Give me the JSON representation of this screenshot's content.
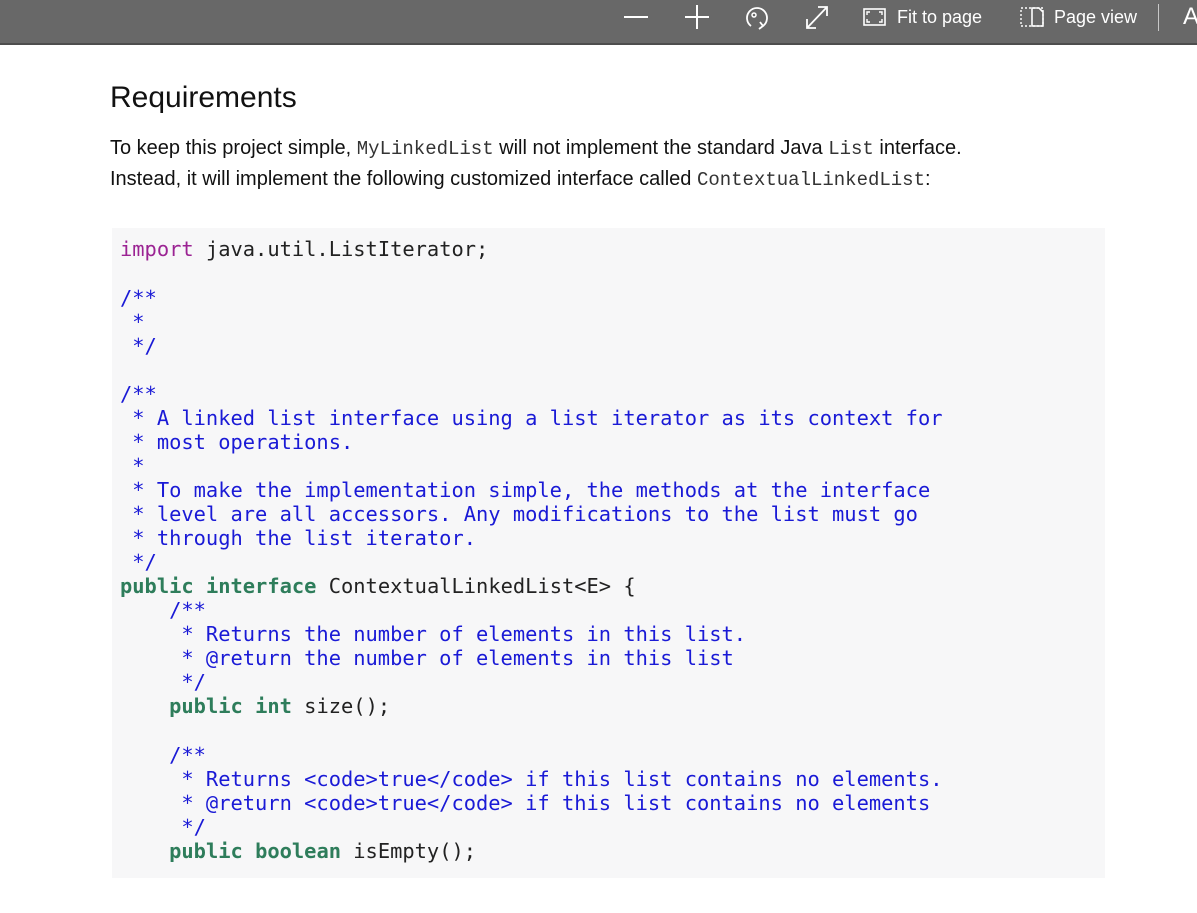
{
  "toolbar": {
    "zoom_out_icon": "minus-icon",
    "zoom_in_icon": "plus-icon",
    "rotate_icon": "rotate-icon",
    "fullscreen_icon": "expand-icon",
    "fit_to_page_label": "Fit to page",
    "page_view_label": "Page view",
    "overflow_label": "A"
  },
  "document": {
    "heading": "Requirements",
    "para": {
      "line1_a": "To keep this project simple, ",
      "line1_code1": "MyLinkedList",
      "line1_b": " will not implement the standard Java ",
      "line1_code2": "List",
      "line1_c": " interface.",
      "line2_a": "Instead, it will implement the following customized interface called ",
      "line2_code": "ContextualLinkedList",
      "line2_b": ":"
    },
    "code": {
      "l1_kw": "import",
      "l1_rest": " java.util.ListIterator;",
      "l2": "/**",
      "l3": " *",
      "l4": " */",
      "l5": "/**",
      "l6": " * A linked list interface using a list iterator as its context for",
      "l7": " * most operations.",
      "l8": " *",
      "l9": " * To make the implementation simple, the methods at the interface",
      "l10": " * level are all accessors. Any modifications to the list must go",
      "l11": " * through the list iterator.",
      "l12": " */",
      "l13_kw1": "public",
      "l13_kw2": "interface",
      "l13_rest": " ContextualLinkedList<E> {",
      "l14": "    /**",
      "l15": "     * Returns the number of elements in this list.",
      "l16": "     * @return the number of elements in this list",
      "l17": "     */",
      "l18_indent": "    ",
      "l18_kw1": "public",
      "l18_kw2": "int",
      "l18_rest": " size();",
      "l19": "    /**",
      "l20": "     * Returns <code>true</code> if this list contains no elements.",
      "l21": "     * @return <code>true</code> if this list contains no elements",
      "l22": "     */",
      "l23_indent": "    ",
      "l23_kw1": "public",
      "l23_kw2": "boolean",
      "l23_rest": " isEmpty();"
    }
  }
}
